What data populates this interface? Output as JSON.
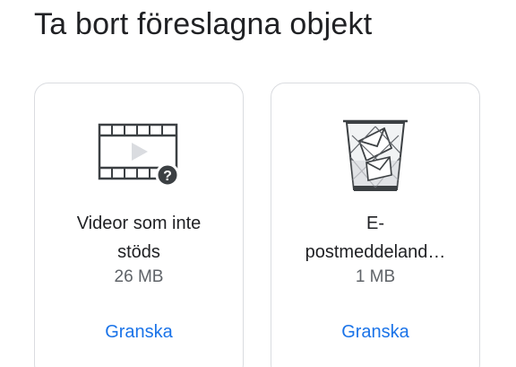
{
  "heading": "Ta bort föreslagna objekt",
  "cards": [
    {
      "icon": "unsupported-video-icon",
      "title_line1": "Videor som inte",
      "title_line2": "stöds",
      "size": "26 MB",
      "action": "Granska"
    },
    {
      "icon": "trash-email-icon",
      "title_line1": "E-",
      "title_line2": "postmeddeland…",
      "size": "1 MB",
      "action": "Granska"
    }
  ],
  "colors": {
    "text": "#202124",
    "secondary": "#5f6368",
    "accent": "#1a73e8",
    "border": "#dadce0"
  }
}
